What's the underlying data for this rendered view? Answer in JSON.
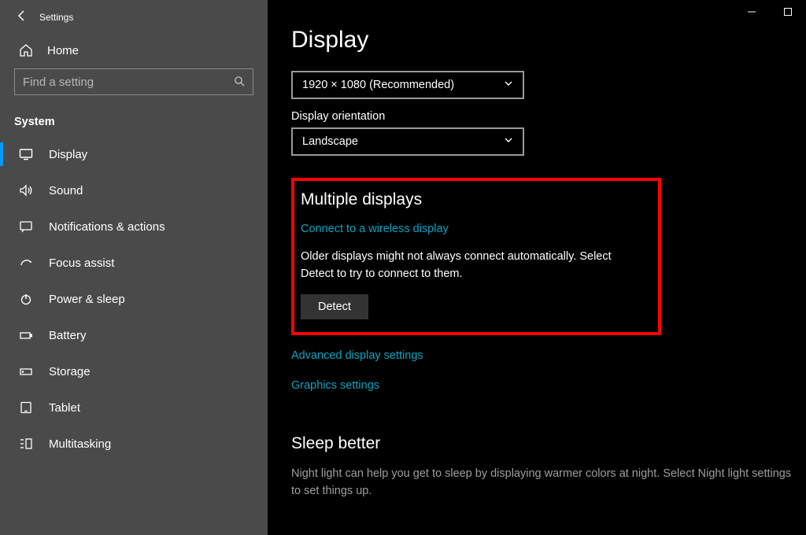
{
  "window": {
    "title": "Settings"
  },
  "sidebar": {
    "home": "Home",
    "search_placeholder": "Find a setting",
    "section": "System",
    "items": [
      {
        "label": "Display"
      },
      {
        "label": "Sound"
      },
      {
        "label": "Notifications & actions"
      },
      {
        "label": "Focus assist"
      },
      {
        "label": "Power & sleep"
      },
      {
        "label": "Battery"
      },
      {
        "label": "Storage"
      },
      {
        "label": "Tablet"
      },
      {
        "label": "Multitasking"
      }
    ]
  },
  "page": {
    "title": "Display",
    "resolution_value": "1920 × 1080 (Recommended)",
    "orientation_label": "Display orientation",
    "orientation_value": "Landscape",
    "multi": {
      "heading": "Multiple displays",
      "wireless_link": "Connect to a wireless display",
      "help": "Older displays might not always connect automatically. Select Detect to try to connect to them.",
      "detect": "Detect"
    },
    "advanced_link": "Advanced display settings",
    "graphics_link": "Graphics settings",
    "sleep": {
      "heading": "Sleep better",
      "desc": "Night light can help you get to sleep by displaying warmer colors at night. Select Night light settings to set things up."
    }
  }
}
